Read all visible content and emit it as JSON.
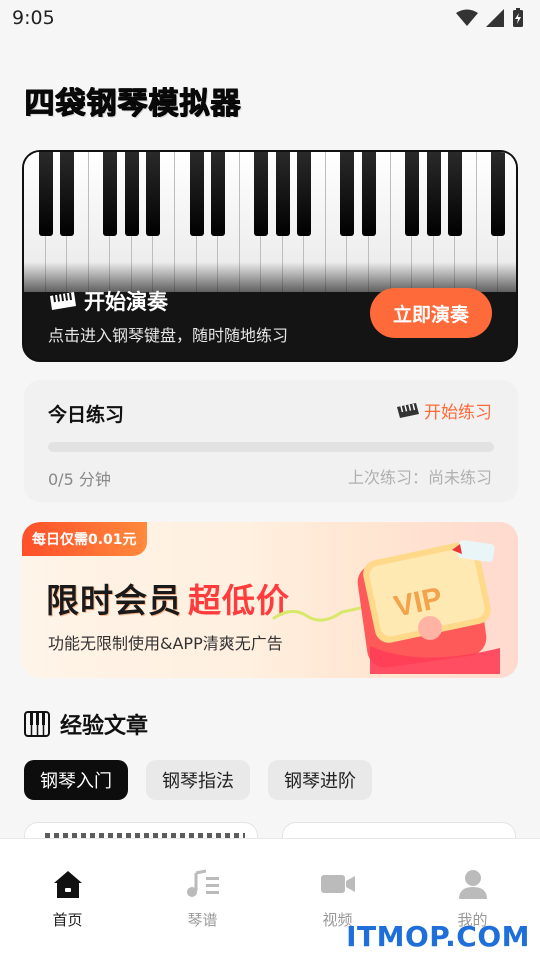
{
  "status_bar": {
    "time": "9:05"
  },
  "app": {
    "title": "四袋钢琴模拟器"
  },
  "piano_card": {
    "heading": "开始演奏",
    "subtitle": "点击进入钢琴键盘，随时随地练习",
    "button_label": "立即演奏"
  },
  "practice": {
    "title": "今日练习",
    "start_link": "开始练习",
    "progress": 0,
    "minutes_text": "0/5 分钟",
    "last_practice_text": "上次练习：尚未练习"
  },
  "vip_banner": {
    "tag": "每日仅需0.01元",
    "headline_a": "限时会员",
    "headline_b": "超低价",
    "subtitle": "功能无限制使用&APP清爽无广告",
    "vip_text": "VIP"
  },
  "articles": {
    "section_title": "经验文章",
    "tabs": [
      {
        "label": "钢琴入门",
        "active": true
      },
      {
        "label": "钢琴指法",
        "active": false
      },
      {
        "label": "钢琴进阶",
        "active": false
      }
    ]
  },
  "bottom_nav": {
    "items": [
      {
        "label": "首页",
        "icon": "home-icon",
        "active": true
      },
      {
        "label": "琴谱",
        "icon": "music-score-icon",
        "active": false
      },
      {
        "label": "视频",
        "icon": "video-icon",
        "active": false
      },
      {
        "label": "我的",
        "icon": "user-icon",
        "active": false
      }
    ]
  },
  "watermark": "ITMOP.COM",
  "colors": {
    "accent": "#ff6a3a",
    "vip_red": "#ff3b3b",
    "dark": "#0d0d0d"
  }
}
